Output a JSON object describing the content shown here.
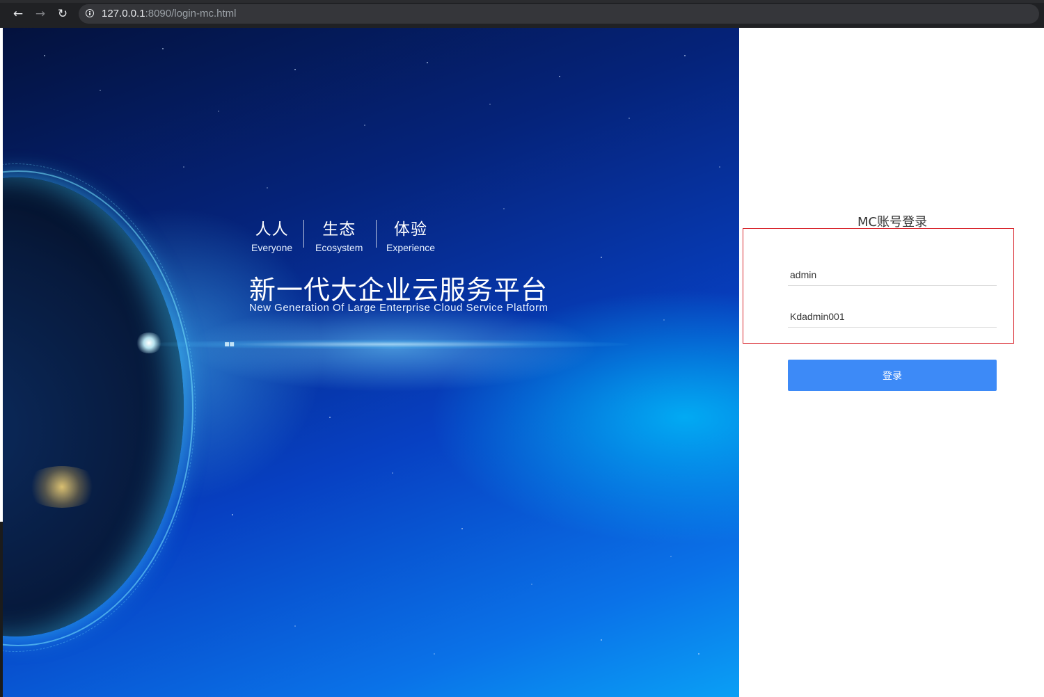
{
  "browser": {
    "url_host": "127.0.0.1",
    "url_rest": ":8090/login-mc.html",
    "back_icon": "arrow-left-icon",
    "forward_icon": "arrow-right-icon",
    "reload_icon": "reload-icon"
  },
  "hero": {
    "taglines": [
      {
        "cn": "人人",
        "en": "Everyone"
      },
      {
        "cn": "生态",
        "en": "Ecosystem"
      },
      {
        "cn": "体验",
        "en": "Experience"
      }
    ],
    "headline": "新一代大企业云服务平台",
    "subline": "New Generation Of Large Enterprise Cloud Service Platform"
  },
  "login": {
    "title": "MC账号登录",
    "username_value": "admin",
    "password_value": "Kdadmin001",
    "submit_label": "登录",
    "accent_color": "#3d8af7",
    "highlight_color": "#d9282f"
  }
}
